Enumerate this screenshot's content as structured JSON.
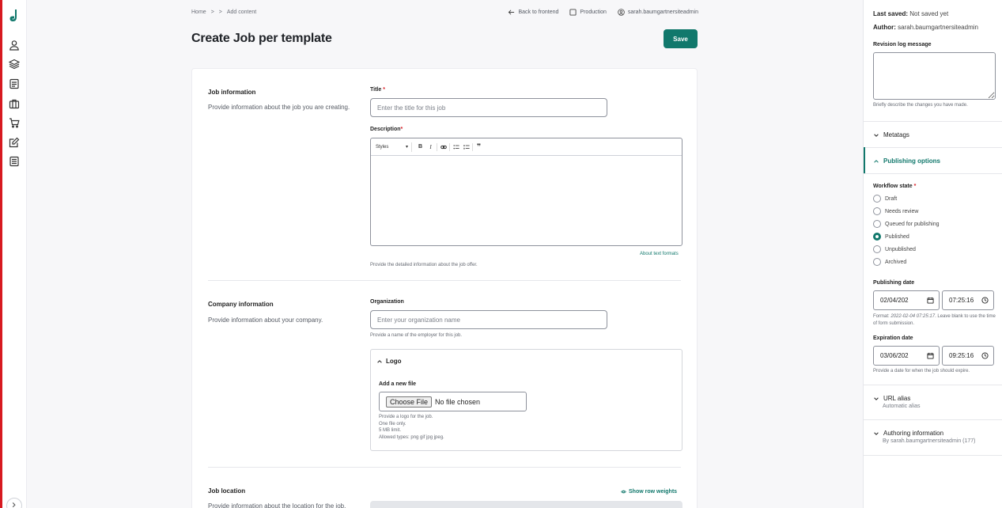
{
  "breadcrumb": {
    "home": "Home",
    "separator": ">",
    "current": "Add content"
  },
  "toplinks": {
    "back": "Back to frontend",
    "env": "Production",
    "user": "sarah.baumgartnersiteadmin"
  },
  "page": {
    "title": "Create Job per template",
    "save_label": "Save"
  },
  "job_info": {
    "title": "Job information",
    "desc": "Provide information about the job you are creating.",
    "title_label": "Title",
    "title_placeholder": "Enter the title for this job",
    "desc_label": "Description",
    "styles_label": "Styles",
    "text_formats_link": "About text formats",
    "desc_help": "Provide the detailed information about the job offer."
  },
  "company_info": {
    "title": "Company information",
    "desc": "Provide information about your company.",
    "org_label": "Organization",
    "org_placeholder": "Enter your organization name",
    "org_help": "Provide a name of the employer for this job.",
    "logo_label": "Logo",
    "add_file_label": "Add a new file",
    "choose_file": "Choose File",
    "no_file": "No file chosen",
    "logo_help": [
      "Provide a logo for the job.",
      "One file only.",
      "5 MB limit.",
      "Allowed types: png gif jpg jpeg."
    ]
  },
  "job_location": {
    "title": "Job location",
    "desc": "Provide information about the location for the job.",
    "row_weights": "Show row weights"
  },
  "sidebar": {
    "last_saved_label": "Last saved:",
    "last_saved_value": "Not saved yet",
    "author_label": "Author:",
    "author_value": "sarah.baumgartnersiteadmin",
    "revision_label": "Revision log message",
    "revision_help": "Briefly describe the changes you have made.",
    "metatags": "Metatags",
    "publishing_options": "Publishing options",
    "workflow_label": "Workflow state",
    "workflow_states": [
      "Draft",
      "Needs review",
      "Queued for publishing",
      "Published",
      "Unpublished",
      "Archived"
    ],
    "workflow_selected": "Published",
    "pub_date_label": "Publishing date",
    "pub_date": "02/04/202",
    "pub_time": "07:25:16",
    "pub_help_prefix": "Format: ",
    "pub_help_format": "2022-02-04 07:25:17",
    "pub_help_suffix": ". Leave blank to use the time of form submission.",
    "exp_date_label": "Expiration date",
    "exp_date": "03/06/202",
    "exp_time": "09:25:16",
    "exp_help": "Provide a date for when the job should expire.",
    "url_alias": "URL alias",
    "url_alias_sub": "Automatic alias",
    "authoring": "Authoring information",
    "authoring_sub": "By sarah.baumgartnersiteadmin (177)"
  },
  "colors": {
    "accent": "#11786c",
    "edge": "#d71920"
  }
}
